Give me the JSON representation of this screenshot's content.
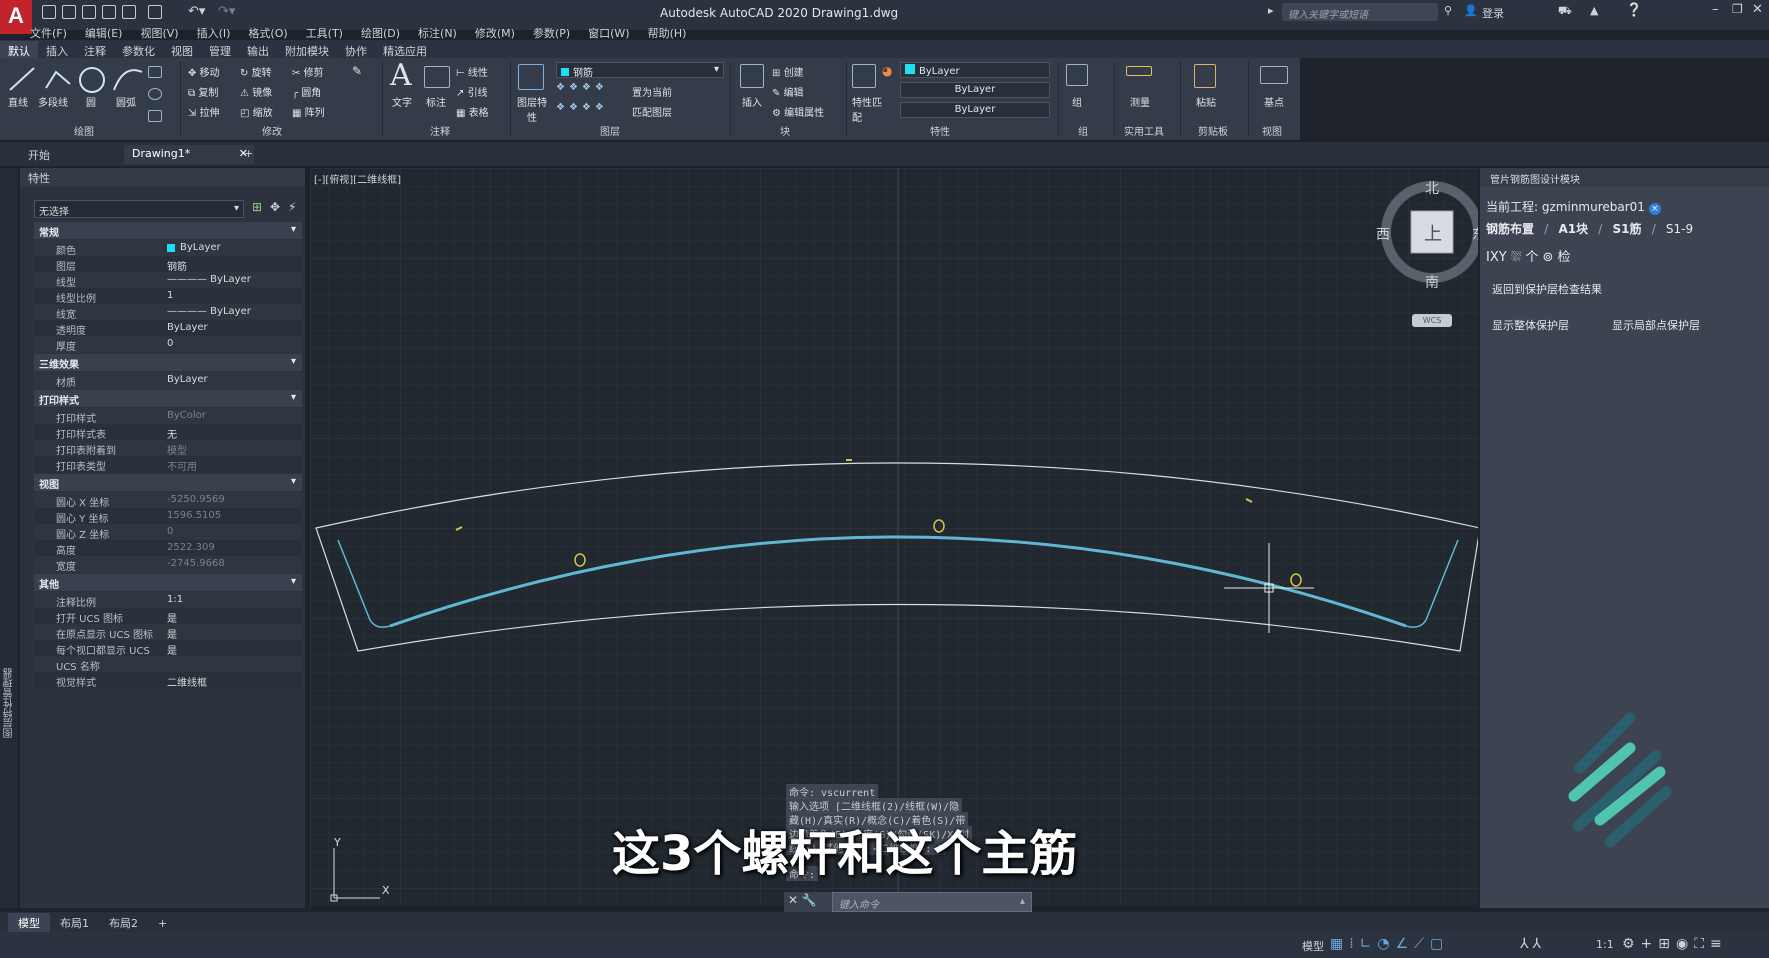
{
  "titlebar": {
    "app_title": "Autodesk AutoCAD 2020    Drawing1.dwg",
    "search_placeholder": "键入关键字或短语",
    "login": "登录"
  },
  "menu": [
    "文件(F)",
    "编辑(E)",
    "视图(V)",
    "插入(I)",
    "格式(O)",
    "工具(T)",
    "绘图(D)",
    "标注(N)",
    "修改(M)",
    "参数(P)",
    "窗口(W)",
    "帮助(H)"
  ],
  "ribbon_tabs": [
    "默认",
    "插入",
    "注释",
    "参数化",
    "视图",
    "管理",
    "输出",
    "附加模块",
    "协作",
    "精选应用"
  ],
  "ribbon": {
    "draw": {
      "title": "绘图",
      "line": "直线",
      "polyline": "多段线",
      "circle": "圆",
      "arc": "圆弧"
    },
    "modify": {
      "title": "修改",
      "move": "移动",
      "rotate": "旋转",
      "trim": "修剪",
      "copy": "复制",
      "mirror": "镜像",
      "fillet": "圆角",
      "stretch": "拉伸",
      "scale": "缩放",
      "array": "阵列"
    },
    "annotation": {
      "title": "注释",
      "text": "文字",
      "dim": "标注",
      "linear": "线性",
      "leader": "引线",
      "table": "表格"
    },
    "layers": {
      "title": "图层",
      "props": "图层特性",
      "layer_name": "钢筋",
      "set_current": "置为当前",
      "match": "匹配图层"
    },
    "block": {
      "title": "块",
      "insert": "插入",
      "create": "创建",
      "edit": "编辑",
      "edit_attr": "编辑属性"
    },
    "properties": {
      "title": "特性",
      "match": "特性匹配",
      "color": "ByLayer",
      "linetype": "ByLayer",
      "lineweight": "ByLayer"
    },
    "groups": {
      "title": "组",
      "group": "组"
    },
    "utilities": {
      "title": "实用工具",
      "measure": "测量"
    },
    "clipboard": {
      "title": "剪贴板",
      "paste": "粘贴"
    },
    "view": {
      "title": "视图",
      "base": "基点"
    }
  },
  "doc_tabs": {
    "start": "开始",
    "drawing": "Drawing1*",
    "close": "✕",
    "add": "+"
  },
  "properties_panel": {
    "title": "特性",
    "selection": "无选择",
    "sections": [
      {
        "name": "常规",
        "rows": [
          [
            "颜色",
            "ByLayer"
          ],
          [
            "图层",
            "钢筋"
          ],
          [
            "线型",
            "———— ByLayer"
          ],
          [
            "线型比例",
            "1"
          ],
          [
            "线宽",
            "———— ByLayer"
          ],
          [
            "透明度",
            "ByLayer"
          ],
          [
            "厚度",
            "0"
          ]
        ]
      },
      {
        "name": "三维效果",
        "rows": [
          [
            "材质",
            "ByLayer"
          ]
        ]
      },
      {
        "name": "打印样式",
        "rows": [
          [
            "打印样式",
            "ByColor"
          ],
          [
            "打印样式表",
            "无"
          ],
          [
            "打印表附着到",
            "模型"
          ],
          [
            "打印表类型",
            "不可用"
          ]
        ]
      },
      {
        "name": "视图",
        "rows": [
          [
            "圆心 X 坐标",
            "-5250.9569"
          ],
          [
            "圆心 Y 坐标",
            "1596.5105"
          ],
          [
            "圆心 Z 坐标",
            "0"
          ],
          [
            "高度",
            "2522.309"
          ],
          [
            "宽度",
            "-2745.9668"
          ]
        ]
      },
      {
        "name": "其他",
        "rows": [
          [
            "注释比例",
            "1:1"
          ],
          [
            "打开 UCS 图标",
            "是"
          ],
          [
            "在原点显示 UCS 图标",
            "是"
          ],
          [
            "每个视口都显示 UCS",
            "是"
          ],
          [
            "UCS 名称",
            ""
          ],
          [
            "视觉样式",
            "二维线框"
          ]
        ]
      }
    ],
    "side_tab": "图层特性管理器"
  },
  "viewport": {
    "label": "[-][俯视][二维线框]",
    "viewcube": {
      "north": "北",
      "south": "南",
      "east": "东",
      "west": "西",
      "top": "上",
      "wcs": "WCS"
    },
    "ucs_x": "X",
    "ucs_y": "Y"
  },
  "right_panel": {
    "title": "管片钢筋图设计模块",
    "project_label": "当前工程:",
    "project_name": "gzminmurebar01",
    "crumbs": [
      "钢筋布置",
      "/",
      "A1块",
      "/",
      "S1筋",
      "/",
      "S1-9"
    ],
    "icons_text": "IXY  ⛆  个  ⊚  检",
    "btn_return": "返回到保护层检查结果",
    "btn_show_all": "显示整体保护层",
    "btn_show_local": "显示局部点保护层"
  },
  "command": {
    "history": [
      "命令: vscurrent",
      "输入选项 [二维线框(2)/线框(W)/隐",
      "藏(H)/真实(R)/概念(C)/着色(S)/带",
      "边缘着色(E)/灰度(G)/勾画(SK)/X 射",
      "线(X)/其他(O)] <二维线框>: 2",
      "命令:"
    ],
    "placeholder": "键入命令"
  },
  "subtitle": "这3个螺杆和这个主筋",
  "layout_tabs": [
    "模型",
    "布局1",
    "布局2",
    "+"
  ],
  "status": {
    "model": "模型",
    "scale": "1:1"
  },
  "colors": {
    "accent": "#5fb7d4",
    "bolt": "#d8c24a",
    "layer_swatch": "#1ee0f0"
  }
}
